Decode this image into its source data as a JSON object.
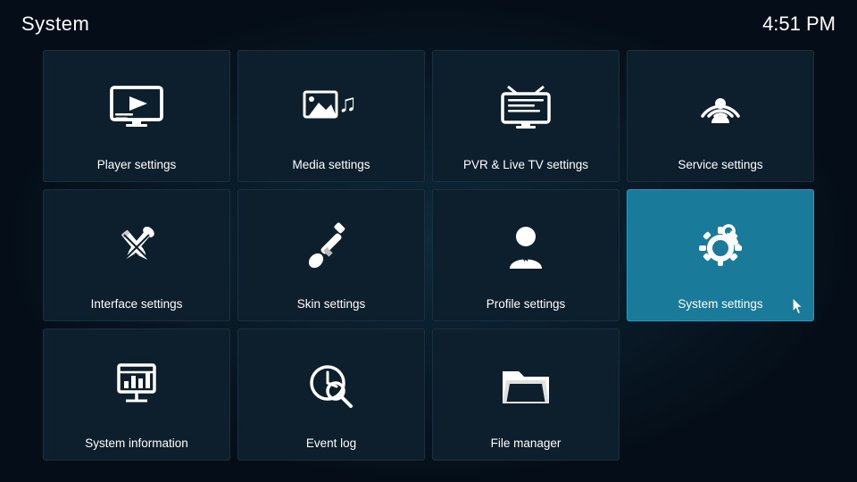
{
  "header": {
    "title": "System",
    "time": "4:51 PM"
  },
  "grid": {
    "items": [
      {
        "id": "player-settings",
        "label": "Player settings",
        "icon": "player",
        "active": false
      },
      {
        "id": "media-settings",
        "label": "Media settings",
        "icon": "media",
        "active": false
      },
      {
        "id": "pvr-settings",
        "label": "PVR & Live TV settings",
        "icon": "pvr",
        "active": false
      },
      {
        "id": "service-settings",
        "label": "Service settings",
        "icon": "service",
        "active": false
      },
      {
        "id": "interface-settings",
        "label": "Interface settings",
        "icon": "interface",
        "active": false
      },
      {
        "id": "skin-settings",
        "label": "Skin settings",
        "icon": "skin",
        "active": false
      },
      {
        "id": "profile-settings",
        "label": "Profile settings",
        "icon": "profile",
        "active": false
      },
      {
        "id": "system-settings",
        "label": "System settings",
        "icon": "system",
        "active": true
      },
      {
        "id": "system-information",
        "label": "System information",
        "icon": "sysinfo",
        "active": false
      },
      {
        "id": "event-log",
        "label": "Event log",
        "icon": "eventlog",
        "active": false
      },
      {
        "id": "file-manager",
        "label": "File manager",
        "icon": "filemanager",
        "active": false
      }
    ]
  }
}
